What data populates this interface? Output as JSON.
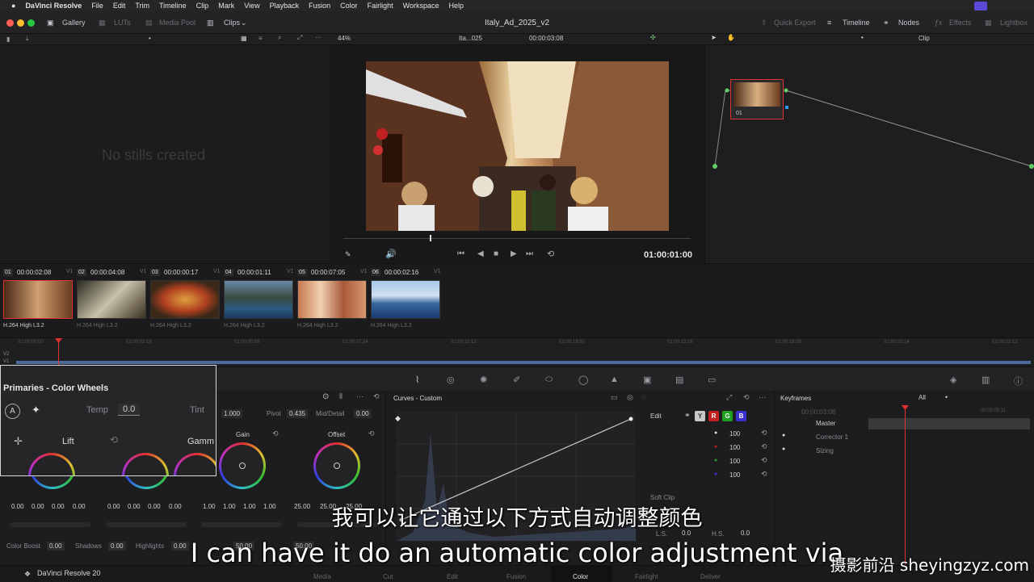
{
  "menubar": {
    "app": "DaVinci Resolve",
    "items": [
      "File",
      "Edit",
      "Trim",
      "Timeline",
      "Clip",
      "Mark",
      "View",
      "Playback",
      "Fusion",
      "Color",
      "Fairlight",
      "Workspace",
      "Help"
    ]
  },
  "topbar": {
    "gallery": "Gallery",
    "luts": "LUTs",
    "media_pool": "Media Pool",
    "clips": "Clips",
    "project_title": "Italy_Ad_2025_v2",
    "quick_export": "Quick Export",
    "timeline": "Timeline",
    "nodes": "Nodes",
    "effects": "Effects",
    "lightbox": "Lightbox"
  },
  "toolbar2": {
    "zoom": "44%",
    "clip_name": "Ita...025",
    "timecode": "00:00:03:08",
    "clip_mode": "Clip"
  },
  "gallery": {
    "empty_text": "No stills created"
  },
  "viewer": {
    "timecode": "01:00:01:00"
  },
  "node": {
    "label": "01"
  },
  "clips": [
    {
      "num": "01",
      "tc": "00:00:02:08",
      "track": "V1",
      "format": "H.264 High L3.2"
    },
    {
      "num": "02",
      "tc": "00:00:04:08",
      "track": "V1",
      "format": "H.264 High L3.2"
    },
    {
      "num": "03",
      "tc": "00:00:00:17",
      "track": "V1",
      "format": "H.264 High L3.2"
    },
    {
      "num": "04",
      "tc": "00:00:01:11",
      "track": "V1",
      "format": "H.264 High L3.2"
    },
    {
      "num": "05",
      "tc": "00:00:07:05",
      "track": "V1",
      "format": "H.264 High L3.2"
    },
    {
      "num": "06",
      "tc": "00:00:02:16",
      "track": "V1",
      "format": "H.264 High L3.2"
    }
  ],
  "timeline": {
    "ticks": [
      "01:00:00:00",
      "01:00:02:16",
      "01:00:05:08",
      "01:00:07:24",
      "01:00:10:12",
      "01:00:13:00",
      "01:00:15:16",
      "01:00:18:08",
      "01:00:20:24",
      "01:00:23:12"
    ],
    "tracks": [
      "V2",
      "V1"
    ]
  },
  "primaries": {
    "title": "Primaries - Color Wheels",
    "temp_label": "Temp",
    "temp_value": "0.0",
    "tint_label": "Tint",
    "lift": "Lift",
    "gamma": "Gamm",
    "gain": "Gain",
    "offset": "Offset",
    "contrast_value": "1.000",
    "pivot_label": "Pivot",
    "pivot_value": "0.435",
    "middetail_label": "Mid/Detail",
    "middetail_value": "0.00",
    "lift_vals": [
      "0.00",
      "0.00",
      "0.00",
      "0.00"
    ],
    "gamma_vals": [
      "0.00",
      "0.00",
      "0.00",
      "0.00"
    ],
    "gain_vals": [
      "1.00",
      "1.00",
      "1.00",
      "1.00"
    ],
    "offset_vals": [
      "25.00",
      "25.00",
      "25.00"
    ],
    "color_boost_label": "Color Boost",
    "color_boost_value": "0.00",
    "shadows_label": "Shadows",
    "shadows_value": "0.00",
    "highlights_label": "Highlights",
    "highlights_value": "0.00",
    "sat_value": "50.00",
    "hue_value": "50.00"
  },
  "curves": {
    "title": "Curves - Custom",
    "edit": "Edit",
    "channels": [
      "Y",
      "R",
      "G",
      "B"
    ],
    "intensities": [
      "100",
      "100",
      "100",
      "100"
    ],
    "soft_clip": "Soft Clip",
    "ls_label": "L.S.",
    "ls_value": "0.0",
    "hs_label": "H.S.",
    "hs_value": "0.0"
  },
  "keyframes": {
    "title": "Keyframes",
    "filter": "All",
    "timecode": "00:00:03:08",
    "end_tc": "00:00:05:11",
    "master": "Master",
    "rows": [
      "Corrector 1",
      "Sizing"
    ]
  },
  "pages": [
    "Media",
    "Cut",
    "Edit",
    "Fusion",
    "Color",
    "Fairlight",
    "Deliver"
  ],
  "brand": "DaVinci Resolve 20",
  "subtitle_cn": "我可以让它通过以下方式自动调整颜色",
  "subtitle_en": "I can have it do an automatic color adjustment via",
  "watermark": "摄影前沿 sheyingzyz.com",
  "colors": {
    "accent": "#d03030",
    "brand_blue": "#3a4ad0",
    "active_page": "#ff5a5a"
  }
}
